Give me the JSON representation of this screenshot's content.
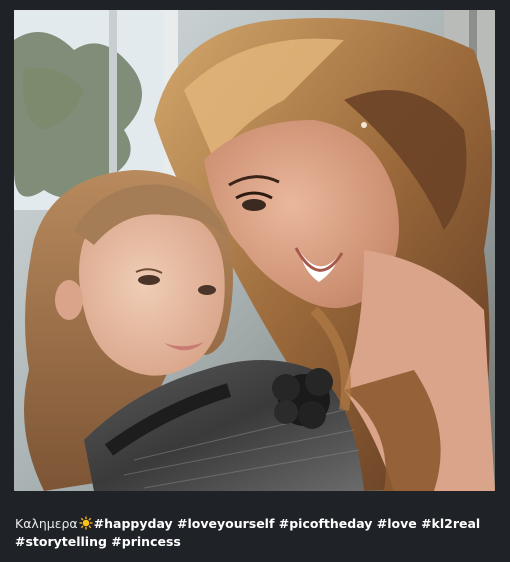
{
  "post": {
    "image": {
      "icon": "selfie-photo",
      "accent_colors": {
        "window_light": "#dfe7ec",
        "hair_blonde": "#c79a5f",
        "hair_dark": "#3a2316",
        "skin": "#e4b095",
        "sweater": "#3b3b3c"
      }
    },
    "caption": {
      "text_before_emoji": "Καλημερα",
      "emoji_icon": "sun-emoji",
      "hashtags_line1": "#happyday #loveyourself #picoftheday #love #kl2real",
      "hashtags_line2": "#storytelling #princess"
    }
  }
}
